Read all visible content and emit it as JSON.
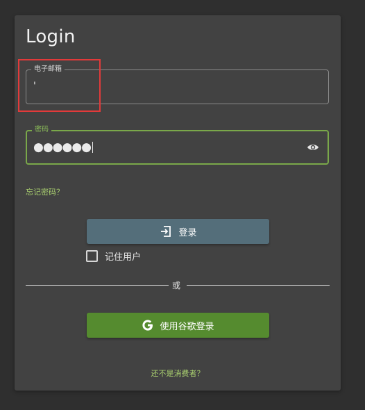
{
  "login": {
    "title": "Login",
    "email": {
      "label": "电子邮箱",
      "value": "'"
    },
    "password": {
      "label": "密码",
      "value": "●●●●●●"
    },
    "forgot_password": "忘记密码？",
    "login_button": "登录",
    "remember_me": "记住用户",
    "divider_or": "或",
    "google_button": "使用谷歌登录",
    "not_consumer": "还不是消费者？"
  },
  "colors": {
    "background": "#2f2f2f",
    "card": "#424242",
    "accent_green": "#7aa84a",
    "link_green": "#a9cf6f",
    "login_button": "#546e7a",
    "google_button": "#558b2f",
    "highlight": "#e23a3a"
  },
  "icons": {
    "eye": "eye-icon",
    "login": "login-icon",
    "google": "google-icon"
  }
}
